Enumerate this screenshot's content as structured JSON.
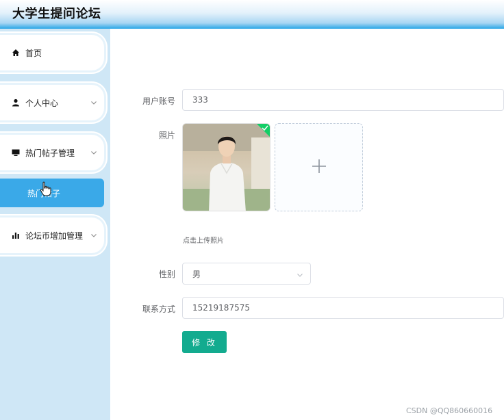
{
  "app": {
    "title": "大学生提问论坛"
  },
  "sidebar": {
    "items": [
      {
        "label": "首页",
        "icon": "home-icon"
      },
      {
        "label": "个人中心",
        "icon": "user-icon"
      },
      {
        "label": "热门帖子管理",
        "icon": "monitor-icon"
      },
      {
        "label": "论坛币增加管理",
        "icon": "bar-chart-icon"
      }
    ],
    "submenu": {
      "label": "热门帖子"
    }
  },
  "form": {
    "account": {
      "label": "用户账号",
      "value": "333"
    },
    "photo": {
      "label": "照片",
      "hint": "点击上传照片"
    },
    "gender": {
      "label": "性别",
      "value": "男"
    },
    "contact": {
      "label": "联系方式",
      "value": "15219187575"
    },
    "submit_label": "修 改"
  },
  "watermark": "CSDN @QQ860660016",
  "colors": {
    "accent": "#3aa9e8",
    "submit": "#13ab8f",
    "sidebar_bg": "#cfe7f6"
  }
}
